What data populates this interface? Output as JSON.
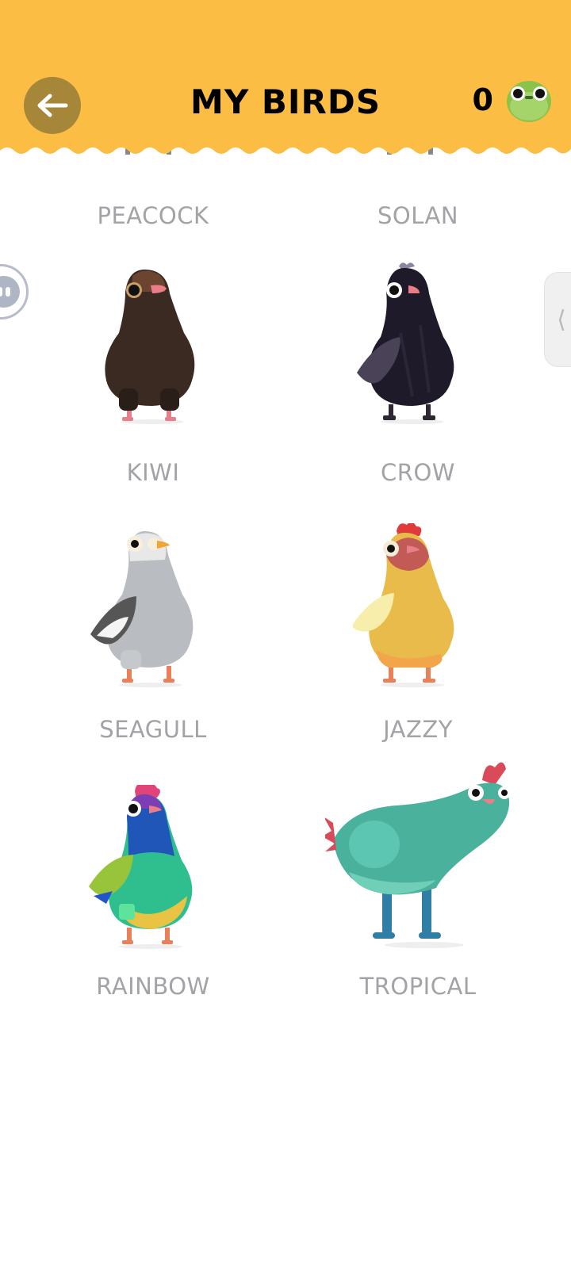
{
  "header": {
    "title": "MY BIRDS",
    "coin_count": "0",
    "back_icon": "arrow-left-icon",
    "coin_icon": "green-bird-coin-icon"
  },
  "birds": [
    {
      "name": "PEACOCK"
    },
    {
      "name": "SOLAN"
    },
    {
      "name": "KIWI"
    },
    {
      "name": "CROW"
    },
    {
      "name": "SEAGULL"
    },
    {
      "name": "JAZZY"
    },
    {
      "name": "RAINBOW"
    },
    {
      "name": "TROPICAL"
    }
  ],
  "edge_tab": {
    "glyph": "⟨"
  },
  "colors": {
    "header_bg": "#fbbd44",
    "back_button_bg": "#a6873a",
    "label_gray": "#a3a3a7"
  }
}
